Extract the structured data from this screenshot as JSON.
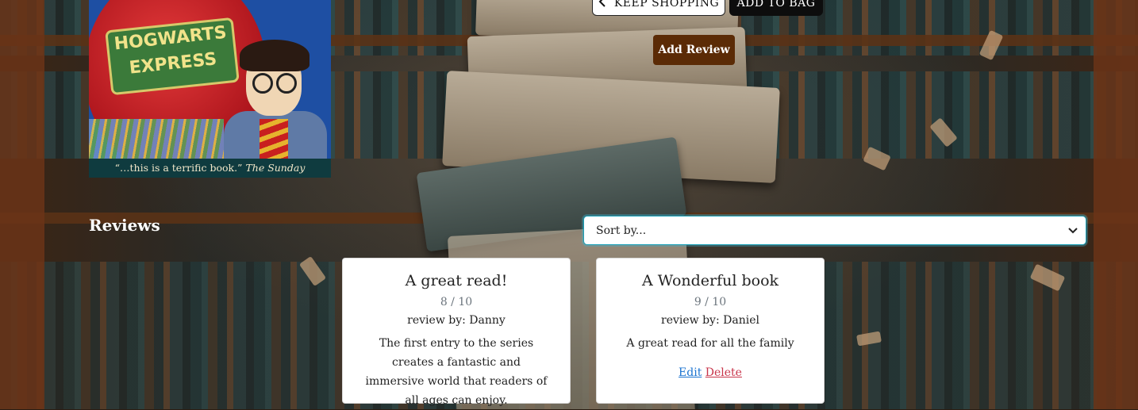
{
  "cover": {
    "plate_line1": "HOGWARTS",
    "plate_line2": "EXPRESS",
    "quote_text": "“…this is a terrific book.”",
    "quote_source": "The Sunday Telegraph"
  },
  "actions": {
    "keep_shopping_label": "KEEP SHOPPING",
    "add_to_bag_label": "ADD TO BAG",
    "add_review_label": "Add Review"
  },
  "reviews": {
    "heading": "Reviews",
    "sort_placeholder": "Sort by...",
    "items": [
      {
        "title": "A great read!",
        "rating": "8 / 10",
        "author": "review by: Danny",
        "body": "The first entry to the series creates a fantastic and immersive world that readers of all ages can enjoy."
      },
      {
        "title": "A Wonderful book",
        "rating": "9 / 10",
        "author": "review by: Daniel",
        "body": "A great read for all the family",
        "edit_label": "Edit",
        "delete_label": "Delete"
      }
    ]
  },
  "colors": {
    "add_review_bg": "#5b2b06",
    "sort_border": "#1aa1b8",
    "edit_link": "#1a73d0",
    "delete_link": "#c8344a"
  }
}
